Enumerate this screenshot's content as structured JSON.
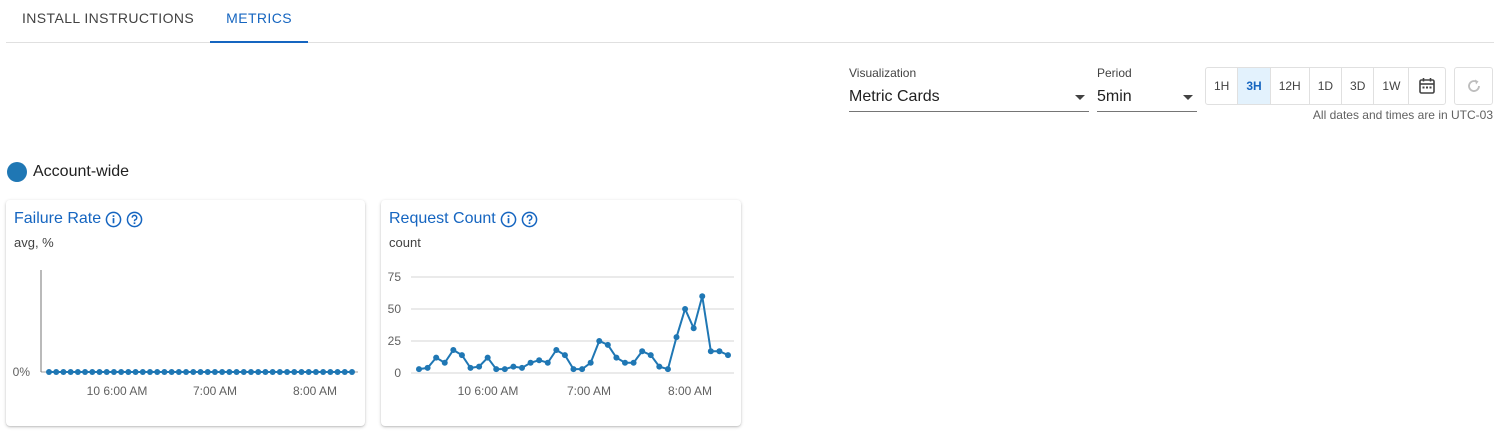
{
  "tabs": [
    {
      "label": "INSTALL INSTRUCTIONS",
      "active": false
    },
    {
      "label": "METRICS",
      "active": true
    }
  ],
  "controls": {
    "visualization": {
      "label": "Visualization",
      "value": "Metric Cards"
    },
    "period": {
      "label": "Period",
      "value": "5min"
    },
    "ranges": [
      "1H",
      "3H",
      "12H",
      "1D",
      "3D",
      "1W"
    ],
    "active_range": "3H",
    "calendar_icon": "calendar-icon",
    "refresh_icon": "refresh-icon",
    "timezone_note": "All dates and times are in UTC-03"
  },
  "scope": {
    "label": "Account-wide",
    "color": "#1f77b4"
  },
  "colors": {
    "accent": "#1565c0",
    "series": "#1f77b4"
  },
  "cards": [
    {
      "title": "Failure Rate",
      "subtitle": "avg, %"
    },
    {
      "title": "Request Count",
      "subtitle": "count"
    }
  ],
  "chart_data": [
    {
      "type": "line",
      "title": "Failure Rate",
      "ylabel": "avg, %",
      "x_ticks": [
        "10 6:00 AM",
        "7:00 AM",
        "8:00 AM"
      ],
      "y_ticks": [
        "0%"
      ],
      "ylim": [
        0,
        1
      ],
      "grid": false,
      "series": [
        {
          "values": [
            0,
            0,
            0,
            0,
            0,
            0,
            0,
            0,
            0,
            0,
            0,
            0,
            0,
            0,
            0,
            0,
            0,
            0,
            0,
            0,
            0,
            0,
            0,
            0,
            0,
            0,
            0,
            0,
            0,
            0,
            0,
            0,
            0,
            0,
            0,
            0,
            0,
            0,
            0,
            0,
            0,
            0,
            0
          ]
        }
      ]
    },
    {
      "type": "line",
      "title": "Request Count",
      "ylabel": "count",
      "x_ticks": [
        "10 6:00 AM",
        "7:00 AM",
        "8:00 AM"
      ],
      "y_ticks": [
        "0",
        "25",
        "50",
        "75"
      ],
      "ylim": [
        0,
        75
      ],
      "grid": true,
      "series": [
        {
          "values": [
            3,
            4,
            12,
            8,
            18,
            14,
            4,
            5,
            12,
            3,
            3,
            5,
            4,
            8,
            10,
            8,
            18,
            14,
            3,
            3,
            8,
            25,
            22,
            12,
            8,
            8,
            17,
            14,
            5,
            3,
            28,
            50,
            35,
            60,
            17,
            17,
            14
          ]
        }
      ]
    }
  ]
}
